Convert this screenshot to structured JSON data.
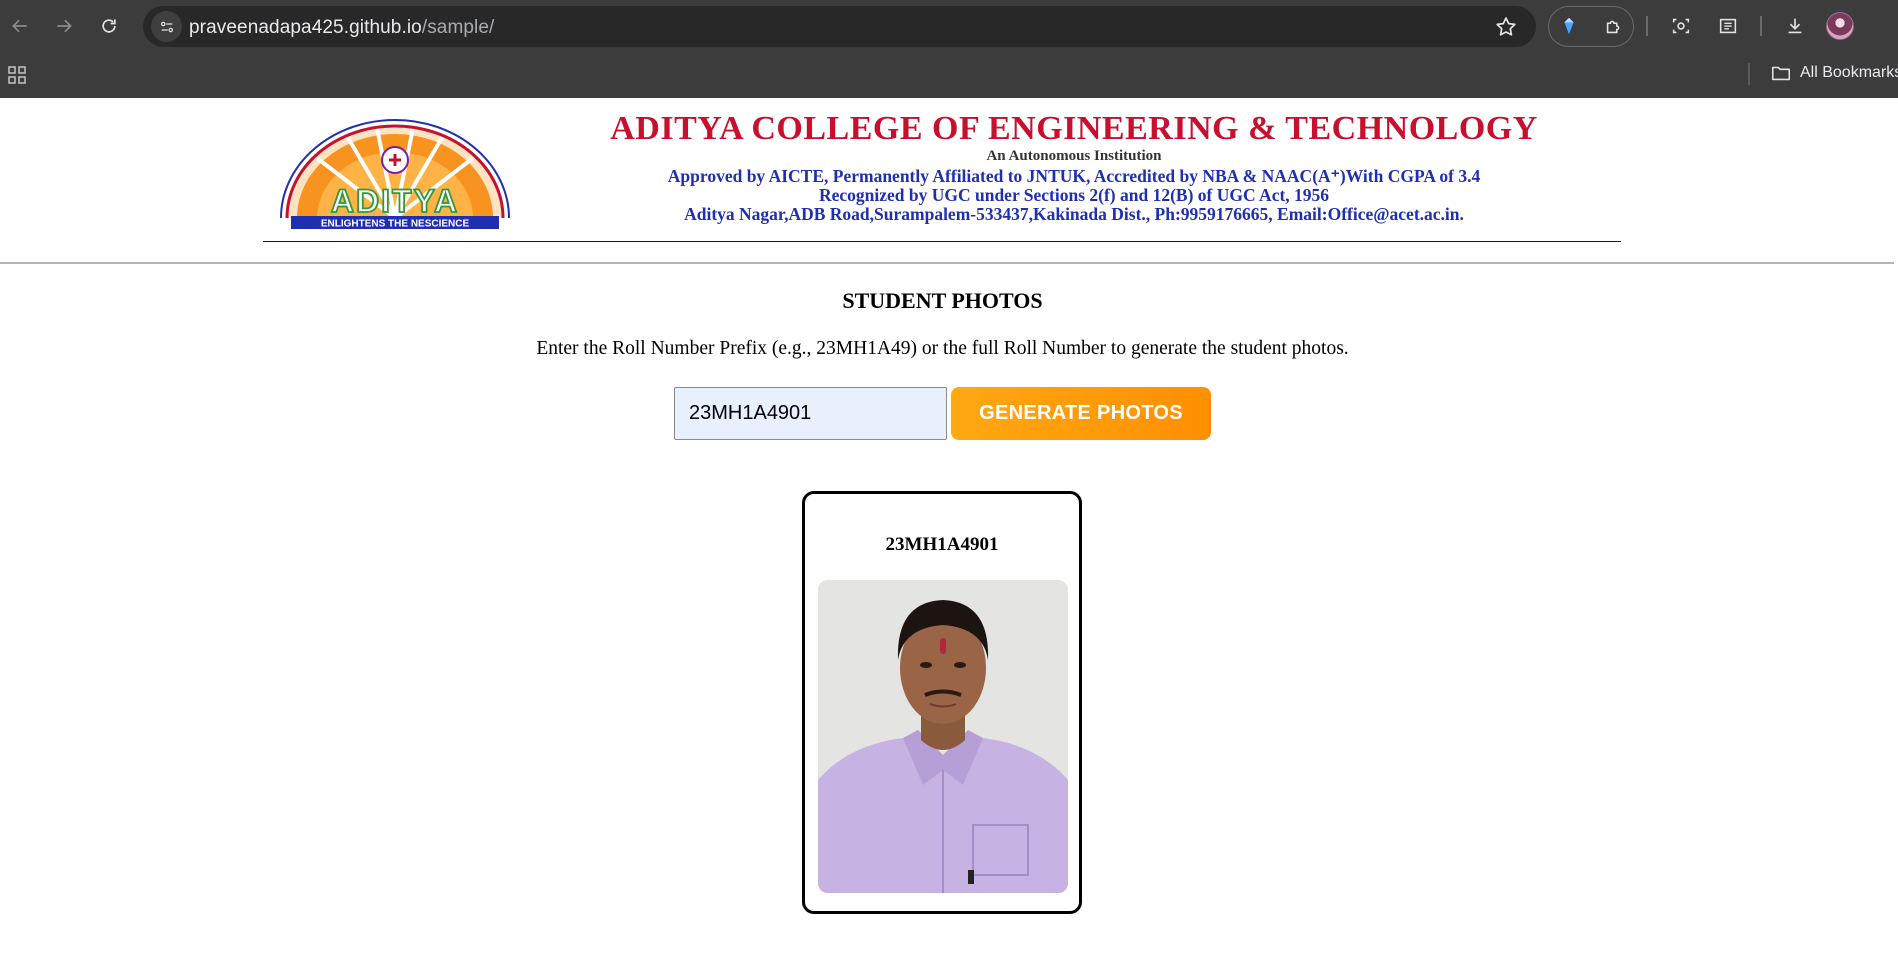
{
  "browser": {
    "url_host": "praveenadapa425.github.io",
    "url_path": "/sample/",
    "bookmarks_label": "All Bookmarks",
    "icons": [
      "back-icon",
      "forward-icon",
      "reload-icon",
      "site-info-icon",
      "star-icon",
      "gemini-icon",
      "extensions-icon",
      "screenshot-icon",
      "reading-list-icon",
      "download-icon",
      "profile-avatar",
      "apps-grid-icon",
      "folder-icon"
    ]
  },
  "banner": {
    "college_name": "ADITYA COLLEGE OF ENGINEERING & TECHNOLOGY",
    "autonomous": "An Autonomous Institution",
    "line1": "Approved by AICTE, Permanently Affiliated to JNTUK, Accredited by NBA & NAAC(A⁺)With CGPA of 3.4",
    "line2": "Recognized by UGC under Sections 2(f) and 12(B) of UGC Act, 1956",
    "line3": "Aditya Nagar,ADB Road,Surampalem-533437,Kakinada Dist., Ph:9959176665, Email:Office@acet.ac.in.",
    "logo_text": "ADITYA",
    "logo_tagline": "ENLIGHTENS THE NESCIENCE",
    "colors": {
      "red": "#c8102e",
      "blue": "#1f2fb0",
      "orange": "#f7931e",
      "green": "#2e9b3a"
    }
  },
  "main": {
    "title": "STUDENT PHOTOS",
    "instruction": "Enter the Roll Number Prefix (e.g., 23MH1A49) or the full Roll Number to generate the student photos.",
    "roll_input_value": "23MH1A4901",
    "generate_button": "GENERATE PHOTOS",
    "button_color": "#ff9a0a"
  },
  "cards": [
    {
      "roll_number": "23MH1A4901"
    }
  ]
}
